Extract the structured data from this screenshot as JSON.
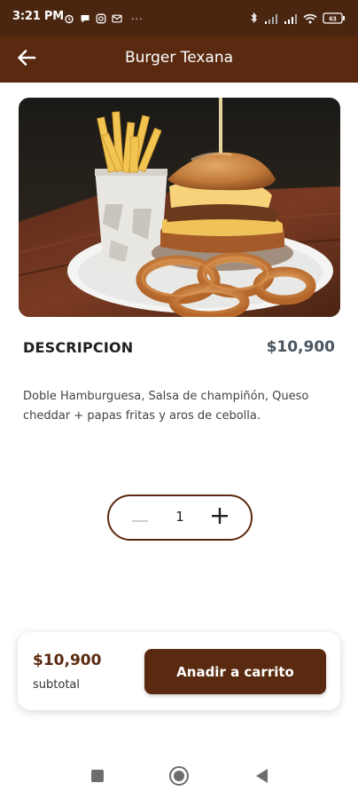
{
  "status_bar": {
    "time": "3:21 PM",
    "overflow": "···",
    "icons_left": [
      "alarm-icon",
      "chat-bubble-icon",
      "instagram-icon",
      "gmail-icon"
    ],
    "icons_right": [
      "bluetooth-icon",
      "signal-icon",
      "signal-icon",
      "wifi-icon",
      "battery-icon"
    ],
    "battery": "63"
  },
  "app_bar": {
    "title": "Burger Texana",
    "back_icon": "arrow-left-icon"
  },
  "product": {
    "image": "burger-with-fries-and-onion-rings",
    "description_heading": "DESCRIPCION",
    "price": "$10,900",
    "description": "Doble Hamburguesa, Salsa de champiñón, Queso cheddar + papas fritas y aros de cebolla."
  },
  "quantity": {
    "value": "1",
    "minus_icon": "minus-icon",
    "plus_icon": "plus-icon"
  },
  "cart": {
    "subtotal_value": "$10,900",
    "subtotal_label": "subtotal",
    "add_button": "Anadir a carrito"
  },
  "nav": {
    "items": [
      "recents-square-icon",
      "home-circle-icon",
      "back-triangle-icon"
    ]
  },
  "colors": {
    "brand": "#5a2a10",
    "status_bar": "#4a2510",
    "price_text": "#4a5560"
  }
}
